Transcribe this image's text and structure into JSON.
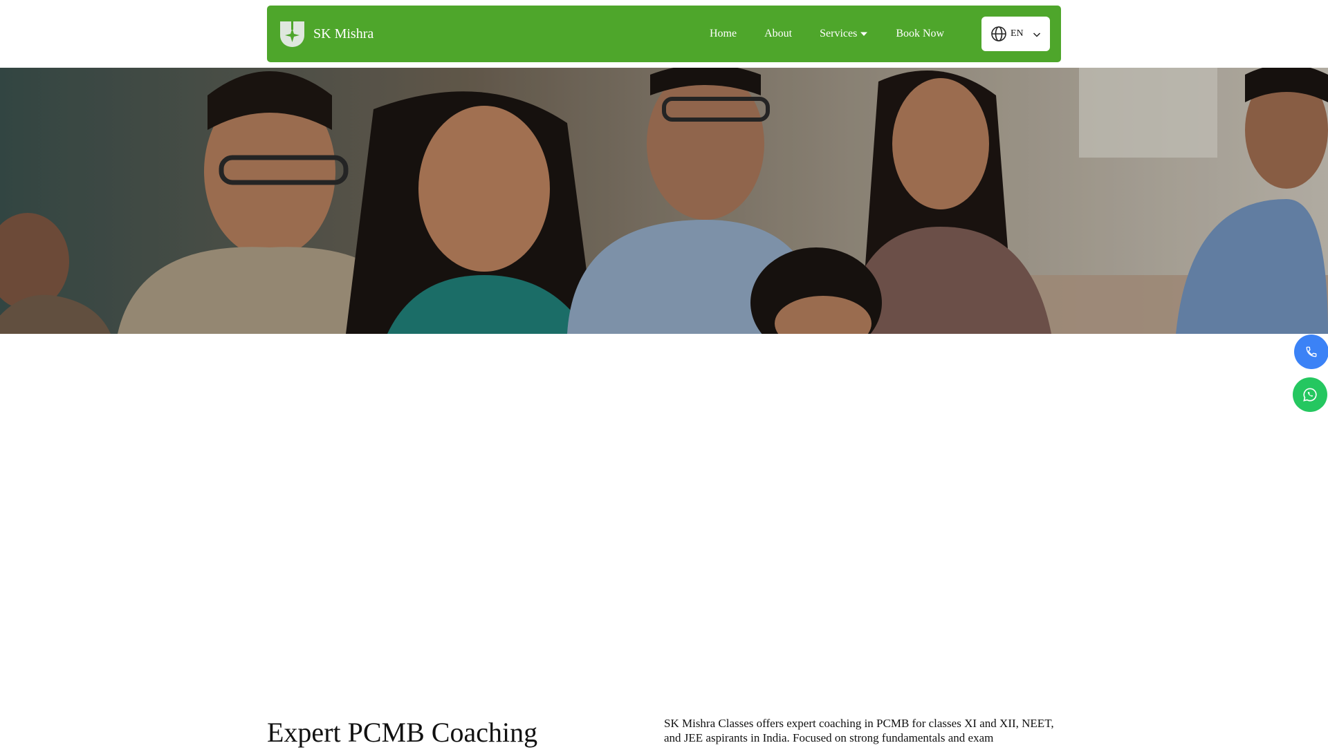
{
  "colors": {
    "navbar": "#4ea62b",
    "nav_text": "#ffffff",
    "phone_button": "#3b82f6",
    "whatsapp_button": "#25c760"
  },
  "header": {
    "brand_name": "SK Mishra",
    "logo_icon": "shield-star-icon",
    "nav": {
      "home": "Home",
      "about": "About",
      "services": "Services",
      "book_now": "Book Now"
    },
    "language": {
      "icon": "globe-icon",
      "selected": "EN"
    }
  },
  "hero": {
    "image_alt": "Students sitting attentively in a classroom"
  },
  "floating_actions": {
    "phone_icon": "phone-icon",
    "whatsapp_icon": "whatsapp-icon"
  },
  "intro": {
    "title": "Expert PCMB Coaching",
    "text": "SK Mishra Classes offers expert coaching in PCMB for classes XI and XII, NEET, and JEE aspirants in India. Focused on strong fundamentals and exam"
  }
}
